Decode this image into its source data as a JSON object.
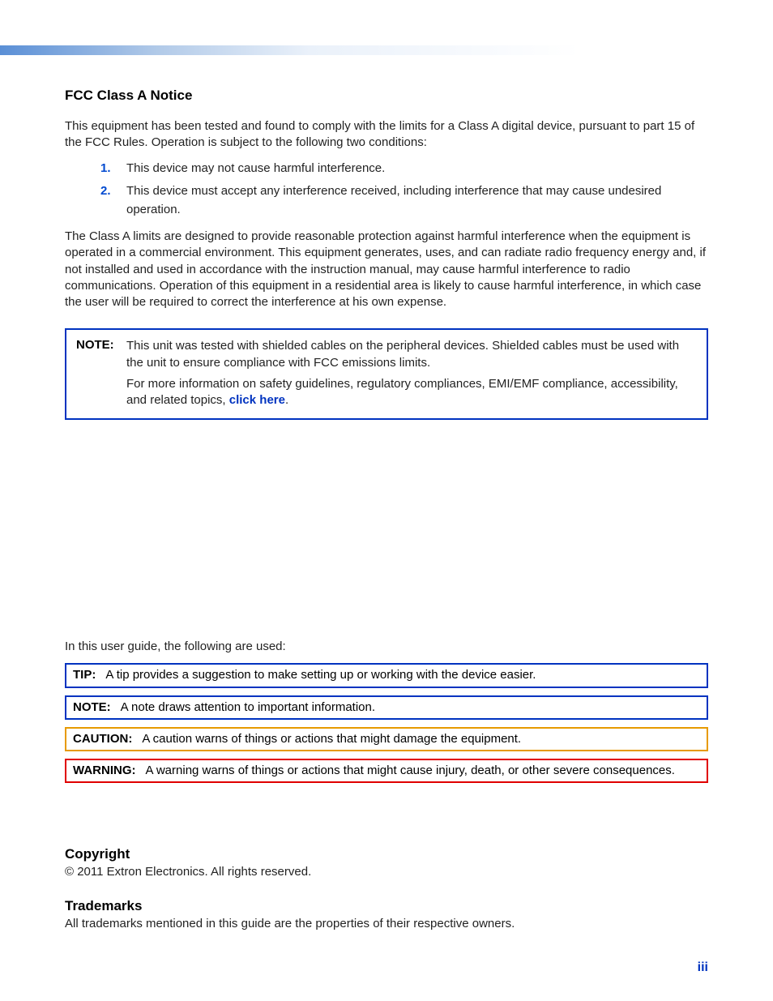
{
  "fcc": {
    "heading": "FCC Class A Notice",
    "intro": "This equipment has been tested and found to comply with the limits for a Class A digital device, pursuant to part 15 of the FCC Rules. Operation is subject to the following two conditions:",
    "items": [
      "This device may not cause harmful interference.",
      "This device must accept any interference received, including interference that may cause undesired operation."
    ],
    "para2": "The Class A limits are designed to provide reasonable protection against harmful interference when the equipment is operated in a commercial environment. This equipment generates, uses, and can radiate radio frequency energy and, if not installed and used in accordance with the instruction manual, may cause harmful interference to radio communications. Operation of this equipment in a residential area is likely to cause harmful interference, in which case the user will be required to correct the interference at his own expense."
  },
  "notebox": {
    "label": "NOTE:",
    "p1": "This unit was tested with shielded cables on the peripheral devices. Shielded cables must be used with the unit to ensure compliance with FCC emissions limits.",
    "p2_prefix": "For more information on safety guidelines, regulatory compliances, EMI/EMF compliance, accessibility, and related topics, ",
    "link": "click here",
    "p2_suffix": "."
  },
  "guide": {
    "intro": "In this user guide, the following are used:",
    "tip_label": "TIP:",
    "tip_text": "A tip provides a suggestion to make setting up or working with the device easier.",
    "note_label": "NOTE:",
    "note_text": "A note draws attention to important information.",
    "caution_label": "CAUTION:",
    "caution_text": "A caution warns of things or actions that might damage the equipment.",
    "warning_label": "WARNING:",
    "warning_text": "A warning warns of things or actions that might cause injury, death, or other severe consequences."
  },
  "copyright": {
    "heading": "Copyright",
    "text": "© 2011  Extron Electronics. All rights reserved."
  },
  "trademarks": {
    "heading": "Trademarks",
    "text": "All trademarks mentioned in this guide are the properties of their respective owners."
  },
  "page_num": "iii"
}
